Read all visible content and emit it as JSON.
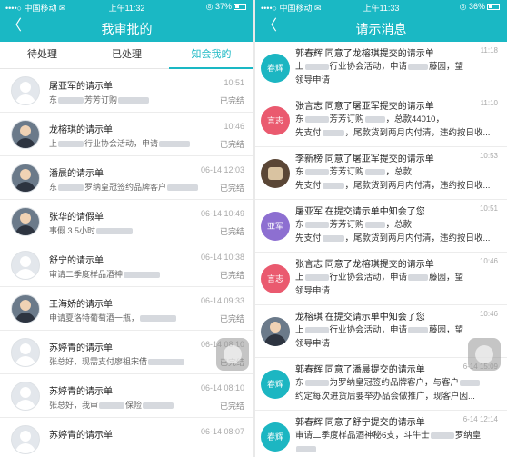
{
  "left": {
    "status": {
      "carrier": "••••○ 中国移动 ✉",
      "time": "上午11:32",
      "battery": "◎ 37%"
    },
    "nav": {
      "back": "〈",
      "title": "我审批的"
    },
    "tabs": [
      "待处理",
      "已处理",
      "知会我的"
    ],
    "items": [
      {
        "name": "屠亚军的请示单",
        "pre": "东",
        "mid": "芳芳订购",
        "post": "",
        "time": "10:51",
        "status": "已完结",
        "avatar": "default"
      },
      {
        "name": "龙榕琪的请示单",
        "pre": "上",
        "mid": "行业协会活动，申请",
        "post": "",
        "time": "10:46",
        "status": "已完结",
        "avatar": "photo"
      },
      {
        "name": "潘晨的请示单",
        "pre": "东",
        "mid": "罗纳皇冠签约品牌客户",
        "post": "",
        "time": "06-14 12:03",
        "status": "已完结",
        "avatar": "photo"
      },
      {
        "name": "张华的请假单",
        "pre": "事假 3.5小时",
        "mid": "",
        "post": "",
        "time": "06-14 10:49",
        "status": "已完结",
        "avatar": "photo"
      },
      {
        "name": "舒宁的请示单",
        "pre": "审请二季度样品酒神",
        "mid": "",
        "post": "",
        "time": "06-14 10:38",
        "status": "已完结",
        "avatar": "default"
      },
      {
        "name": "王海娇的请示单",
        "pre": "申请夏洛特葡萄酒一瓶，",
        "mid": "",
        "post": "",
        "time": "06-14 09:33",
        "status": "已完结",
        "avatar": "photo"
      },
      {
        "name": "苏婷青的请示单",
        "pre": "张总好，现需支付廖祖宋借",
        "mid": "",
        "post": "",
        "time": "06-14 08:10",
        "status": "已完结",
        "avatar": "default"
      },
      {
        "name": "苏婷青的请示单",
        "pre": "张总好，我审",
        "mid": "保险",
        "post": "",
        "time": "06-14 08:10",
        "status": "已完结",
        "avatar": "default"
      },
      {
        "name": "苏婷青的请示单",
        "pre": "",
        "mid": "",
        "post": "",
        "time": "06-14 08:07",
        "status": "",
        "avatar": "default"
      }
    ]
  },
  "right": {
    "status": {
      "carrier": "••••○ 中国移动 ✉",
      "time": "上午11:33",
      "battery": "◎ 36%"
    },
    "nav": {
      "back": "〈",
      "title": "请示消息"
    },
    "items": [
      {
        "avatar": "春辉",
        "color": "c1",
        "title": "郭春辉  同意了龙榕琪提交的请示单",
        "time": "11:18",
        "line1": "上",
        "line1b": "行业协会活动，申请",
        "line1c": "藤园，望",
        "line2": "领导申请"
      },
      {
        "avatar": "言志",
        "color": "c2",
        "title": "张言志  同意了屠亚军提交的请示单",
        "time": "11:10",
        "line1": "东",
        "line1b": "芳芳订购",
        "line1c": "，总款44010，",
        "line2": "先支付",
        "line2b": "，尾款货到两月内付清，违约按日收..."
      },
      {
        "avatar": "",
        "color": "obj",
        "title": "李新榜  同意了屠亚军提交的请示单",
        "time": "10:53",
        "line1": "东",
        "line1b": "芳芳订购",
        "line1c": "，总款",
        "line2": "先支付",
        "line2b": "，尾款货到两月内付清，违约按日收..."
      },
      {
        "avatar": "亚军",
        "color": "c3",
        "title": "屠亚军  在提交请示单中知会了您",
        "time": "10:51",
        "line1": "东",
        "line1b": "芳芳订购",
        "line1c": "，总款",
        "line2": "先支付",
        "line2b": "，尾款货到两月内付清，违约按日收..."
      },
      {
        "avatar": "言志",
        "color": "c2",
        "title": "张言志  同意了龙榕琪提交的请示单",
        "time": "10:46",
        "line1": "上",
        "line1b": "行业协会活动，申请",
        "line1c": "藤园，望",
        "line2": "领导申请"
      },
      {
        "avatar": "",
        "color": "photo",
        "title": "龙榕琪  在提交请示单中知会了您",
        "time": "10:46",
        "line1": "上",
        "line1b": "行业协会活动，申请",
        "line1c": "藤园，望",
        "line2": "领导申请"
      },
      {
        "avatar": "春辉",
        "color": "c1",
        "title": "郭春辉  同意了潘晨提交的请示单",
        "time": "6-14 15:09",
        "line1": "东",
        "line1b": "为罗纳皇冠签约品牌客户，与客户",
        "line1c": "",
        "line2": "约定每次进货后要举办品会做推广，现客户因..."
      },
      {
        "avatar": "春辉",
        "color": "c1",
        "title": "郭春辉  同意了舒宁提交的请示单",
        "time": "6-14 12:14",
        "line1": "审请二季度样品酒神秘6支，斗牛士",
        "line1b": "罗纳皇",
        "line1c": "",
        "line2": "冠",
        "line2b": "源品规"
      }
    ]
  }
}
